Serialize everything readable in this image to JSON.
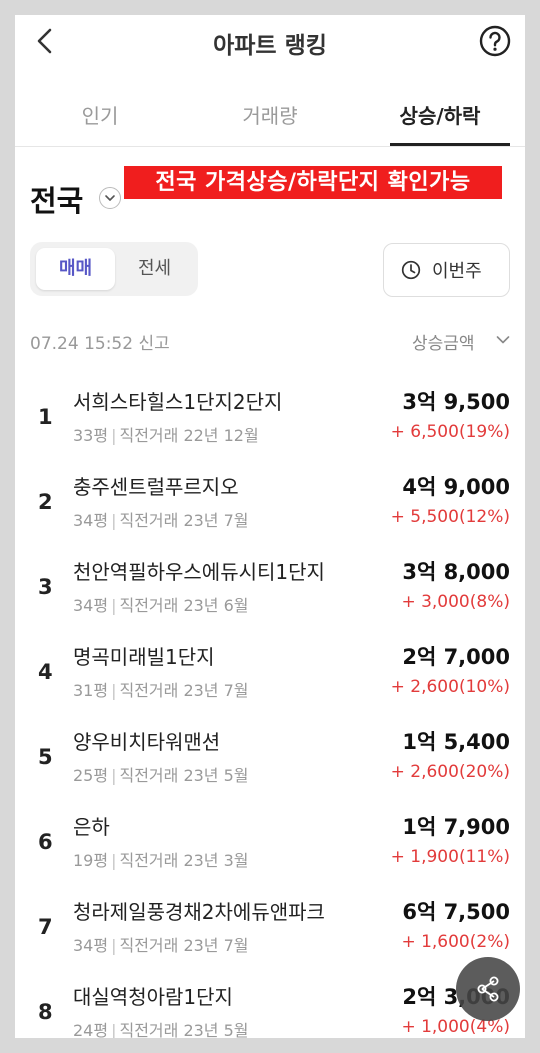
{
  "header": {
    "title": "아파트 랭킹",
    "back_icon": "chevron-left-icon",
    "help_icon": "question-circle-icon"
  },
  "tabs": [
    {
      "label": "인기",
      "active": false
    },
    {
      "label": "거래량",
      "active": false
    },
    {
      "label": "상승/하락",
      "active": true
    }
  ],
  "region": {
    "label": "전국",
    "chevron_icon": "chevron-down-circle-icon"
  },
  "banner": {
    "text": "전국 가격상승/하락단지 확인가능",
    "color": "#f01e1e"
  },
  "deal_type": {
    "options": [
      "매매",
      "전세"
    ],
    "selected": "매매",
    "accent": "#5757c6"
  },
  "period_button": {
    "label": "이번주",
    "icon": "clock-icon"
  },
  "report": {
    "time": "07.24 15:52 신고"
  },
  "sort": {
    "label": "상승금액",
    "icon": "chevron-down-icon"
  },
  "colors": {
    "increase": "#e23b3b"
  },
  "rankings": [
    {
      "rank": "1",
      "name": "서희스타힐스1단지2단지",
      "size": "33평",
      "last_trade": "직전거래 22년 12월",
      "price": "3억 9,500",
      "change": "+ 6,500(19%)"
    },
    {
      "rank": "2",
      "name": "충주센트럴푸르지오",
      "size": "34평",
      "last_trade": "직전거래 23년 7월",
      "price": "4억 9,000",
      "change": "+ 5,500(12%)"
    },
    {
      "rank": "3",
      "name": "천안역필하우스에듀시티1단지",
      "size": "34평",
      "last_trade": "직전거래 23년 6월",
      "price": "3억 8,000",
      "change": "+ 3,000(8%)"
    },
    {
      "rank": "4",
      "name": "명곡미래빌1단지",
      "size": "31평",
      "last_trade": "직전거래 23년 7월",
      "price": "2억 7,000",
      "change": "+ 2,600(10%)"
    },
    {
      "rank": "5",
      "name": "양우비치타워맨션",
      "size": "25평",
      "last_trade": "직전거래 23년 5월",
      "price": "1억 5,400",
      "change": "+ 2,600(20%)"
    },
    {
      "rank": "6",
      "name": "은하",
      "size": "19평",
      "last_trade": "직전거래 23년 3월",
      "price": "1억 7,900",
      "change": "+ 1,900(11%)"
    },
    {
      "rank": "7",
      "name": "청라제일풍경채2차에듀앤파크",
      "size": "34평",
      "last_trade": "직전거래 23년 7월",
      "price": "6억 7,500",
      "change": "+ 1,600(2%)"
    },
    {
      "rank": "8",
      "name": "대실역청아람1단지",
      "size": "24평",
      "last_trade": "직전거래 23년 5월",
      "price": "2억 3,000",
      "change": "+ 1,000(4%)"
    }
  ],
  "share_button": {
    "icon": "share-icon"
  }
}
